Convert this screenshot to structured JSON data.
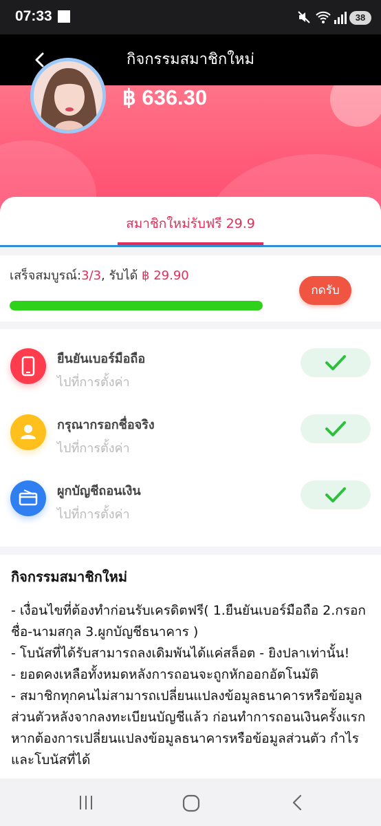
{
  "status_bar": {
    "time": "07:33",
    "battery": "38"
  },
  "header": {
    "title": "กิจกรรมสมาชิกใหม่"
  },
  "balance": "฿ 636.30",
  "tab": {
    "label": "สมาชิกใหม่รับฟรี 29.9"
  },
  "progress": {
    "prefix": "เสร็จสมบูรณ์:",
    "count": "3/3",
    "mid": ", รับได้ ",
    "amount": "฿ 29.90",
    "claim_label": "กดรับ",
    "completion": 1.0
  },
  "tasks": [
    {
      "name": "ยืนยันเบอร์มือถือ",
      "sub": "ไปที่การตั้งค่า",
      "icon": "phone-icon",
      "color": "#ff3b4e"
    },
    {
      "name": "กรุณากรอกชื่อจริง",
      "sub": "ไปที่การตั้งค่า",
      "icon": "person-icon",
      "color": "#ffbf1c"
    },
    {
      "name": "ผูกบัญชีถอนเงิน",
      "sub": "ไปที่การตั้งค่า",
      "icon": "card-icon",
      "color": "#2f7ff0"
    }
  ],
  "rules": {
    "title": "กิจกรรมสมาชิกใหม่",
    "lines": [
      "- เงื่อนไขที่ต้องทำก่อนรับเครดิตฟรี( 1.ยืนยันเบอร์มือถือ  2.กรอกชื่อ-นามสกุล  3.ผูกบัญชีธนาคาร )",
      "- โบนัสที่ได้รับสามารถลงเดิมพันได้แค่สล็อต - ยิงปลาเท่านั้น!",
      "- ยอดคงเหลือทั้งหมดหลังการถอนจะถูกหักออกอัตโนมัติ",
      "- สมาชิกทุกคนไม่สามารถเปลี่ยนแปลงข้อมูลธนาคารหรือข้อมูลส่วนตัวหลังจากลงทะเบียนบัญชีแล้ว ก่อนทำการถอนเงินครั้งแรก หากต้องการเปลี่ยนแปลงข้อมูลธนาคารหรือข้อมูลส่วนตัว กำไรและโบนัสที่ได้"
    ]
  },
  "colors": {
    "accent": "#e0305a",
    "progress_fill": "#2fd21a",
    "claim_button": "#f05541",
    "check": "#2fbf3c"
  }
}
